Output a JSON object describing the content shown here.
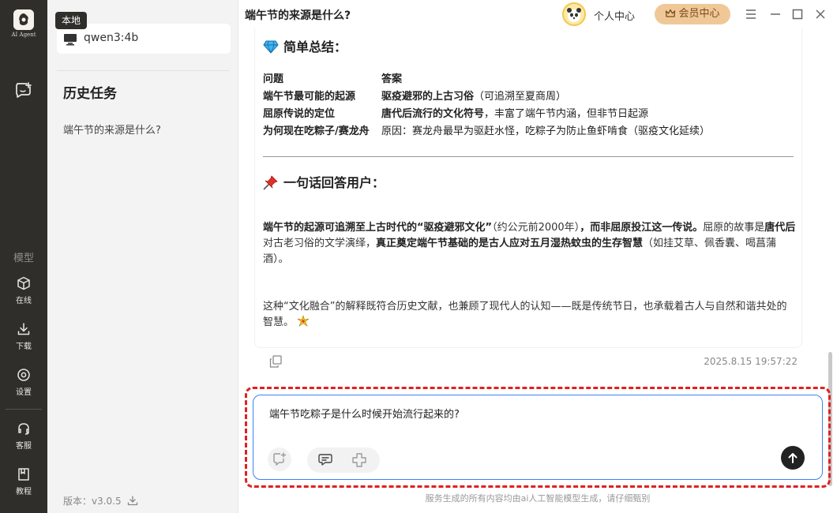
{
  "app": {
    "logo_text": "AI Agent",
    "rail_section": "模型",
    "nav": [
      {
        "label": "在线",
        "icon": "cube-icon"
      },
      {
        "label": "下载",
        "icon": "download-icon"
      },
      {
        "label": "设置",
        "icon": "settings-icon"
      },
      {
        "label": "客服",
        "icon": "headset-icon"
      },
      {
        "label": "教程",
        "icon": "book-icon"
      }
    ]
  },
  "sidebar": {
    "local_badge": "本地",
    "model_name": "qwen3:4b",
    "history_title": "历史任务",
    "history_items": [
      "端午节的来源是什么?"
    ],
    "version": "版本：v3.0.5"
  },
  "topbar": {
    "chat_title": "端午节的来源是什么?",
    "user_center": "个人中心",
    "vip_label": "会员中心"
  },
  "message": {
    "summary_heading": "简单总结：",
    "table": {
      "headers": [
        "问题",
        "答案"
      ],
      "rows": [
        {
          "q": "端午节最可能的起源",
          "a_bold": "驱疫避邪的上古习俗",
          "a_rest": "（可追溯至夏商周）"
        },
        {
          "q": "屈原传说的定位",
          "a_bold": "唐代后流行的文化符号",
          "a_rest": "，丰富了端午节内涵，但非节日起源"
        },
        {
          "q": "为何现在吃粽子/赛龙舟",
          "a_bold": "",
          "a_rest": "原因：赛龙舟最早为驱赶水怪，吃粽子为防止鱼虾啃食（驱疫文化延续）"
        }
      ]
    },
    "answer_heading": "一句话回答用户：",
    "p1": {
      "s1": "端午节的起源可追溯至上古时代的“驱疫避邪文化”",
      "s2": "（约公元前2000年）",
      "s3": "，而非屈原投江这一传说。",
      "s4": "屈原的故事是",
      "s5": "唐代后",
      "s6": "对古老习俗的文学演绎，",
      "s7": "真正奠定端午节基础的是古人应对五月湿热蚊虫的生存智慧",
      "s8": "（如挂艾草、佩香囊、喝菖蒲酒）。"
    },
    "p2": "这种“文化融合”的解释既符合历史文献，也兼顾了现代人的认知——既是传统节日，也承载着古人与自然和谐共处的智慧。",
    "timestamp": "2025.8.15 19:57:22"
  },
  "input": {
    "text": "端午节吃粽子是什么时候开始流行起来的?"
  },
  "footer": {
    "disclaimer": "服务生成的所有内容均由ai人工智能模型生成，请仔细甄别"
  },
  "colors": {
    "rail_bg": "#2f2e2b",
    "vip_bg": "#f0c897",
    "input_border": "#3b82f6",
    "annotation_dash": "#e02020"
  }
}
